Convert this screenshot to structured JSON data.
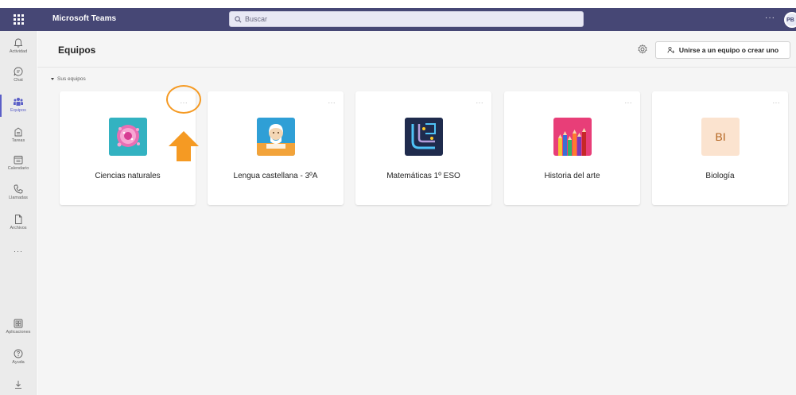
{
  "app": {
    "title": "Microsoft Teams",
    "avatar_initials": "PB",
    "more": "···"
  },
  "search": {
    "placeholder": "Buscar"
  },
  "rail": {
    "items": [
      {
        "label": "Actividad",
        "icon": "bell-icon"
      },
      {
        "label": "Chat",
        "icon": "chat-icon"
      },
      {
        "label": "Equipos",
        "icon": "teams-icon",
        "active": true
      },
      {
        "label": "Tareas",
        "icon": "assignments-icon"
      },
      {
        "label": "Calendario",
        "icon": "calendar-icon"
      },
      {
        "label": "Llamadas",
        "icon": "phone-icon"
      },
      {
        "label": "Archivos",
        "icon": "file-icon"
      }
    ],
    "more": "···",
    "bottom": [
      {
        "label": "Aplicaciones",
        "icon": "apps-icon"
      },
      {
        "label": "Ayuda",
        "icon": "help-icon"
      }
    ]
  },
  "header": {
    "title": "Equipos",
    "join_label": "Unirse a un equipo o crear uno"
  },
  "section": {
    "label": "Sus equipos"
  },
  "teams": [
    {
      "name": "Ciencias naturales",
      "more": "···"
    },
    {
      "name": "Lengua castellana - 3ºA",
      "more": "···"
    },
    {
      "name": "Matemáticas 1º ESO",
      "more": "···"
    },
    {
      "name": "Historia del arte",
      "more": "···"
    },
    {
      "name": "Biología",
      "more": "···",
      "initials": "BI"
    }
  ],
  "colors": {
    "topbar": "#464775",
    "accent": "#5b5fc7",
    "highlight": "#f59a23"
  }
}
